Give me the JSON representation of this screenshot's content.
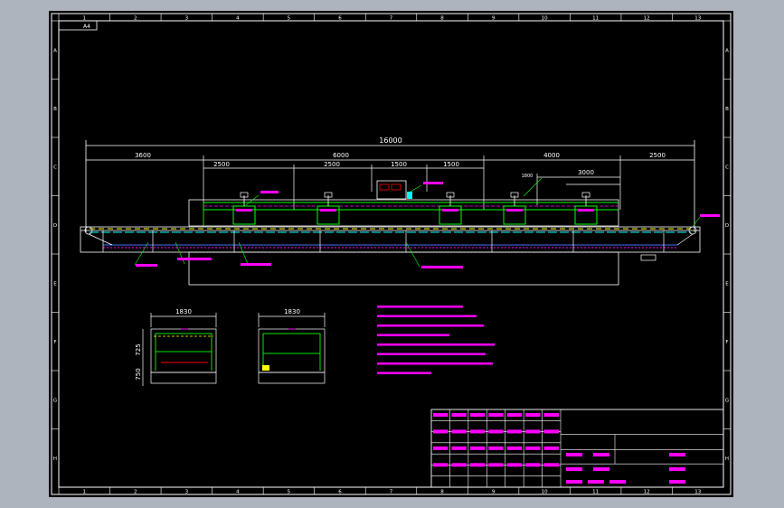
{
  "frame": {
    "title_code": "A4",
    "zone_numbers": [
      "1",
      "2",
      "3",
      "4",
      "5",
      "6",
      "7",
      "8",
      "9",
      "10",
      "11",
      "12",
      "13"
    ],
    "zone_letters": [
      "A",
      "B",
      "C",
      "D",
      "E",
      "F",
      "G",
      "H"
    ]
  },
  "main_view": {
    "overall_length": "16000",
    "seg_top": [
      "3600",
      "6000",
      "4000",
      "2500"
    ],
    "seg_mid": [
      "2500",
      "2500",
      "1500",
      "1500"
    ],
    "seg_small": [
      "1800",
      "3000"
    ],
    "leaders": [
      "",
      "",
      "",
      "",
      "",
      "",
      "",
      ""
    ]
  },
  "side_views": {
    "left_width": "1830",
    "right_width": "1830",
    "h_top": "725",
    "h_bottom": "750"
  },
  "tech_notes": {
    "title": "",
    "lines": [
      "",
      "",
      "",
      "",
      "",
      "",
      "",
      ""
    ]
  },
  "title_block": {
    "cells_left": [
      "",
      "",
      "",
      "",
      "",
      "",
      "",
      "",
      "",
      "",
      "",
      "",
      "",
      "",
      "",
      "",
      "",
      "",
      "",
      "",
      "",
      "",
      "",
      "",
      "",
      "",
      "",
      ""
    ],
    "cells_right": [
      "",
      "",
      "",
      "",
      "",
      "",
      "",
      "",
      "",
      ""
    ]
  },
  "colors": {
    "frame": "#ffffff",
    "dim": "#ffffff",
    "green": "#00ff00",
    "magenta": "#ff00ff",
    "cyan": "#00ffff",
    "yellow": "#ffff00",
    "red": "#ff0000",
    "blue": "#4a6cff"
  }
}
